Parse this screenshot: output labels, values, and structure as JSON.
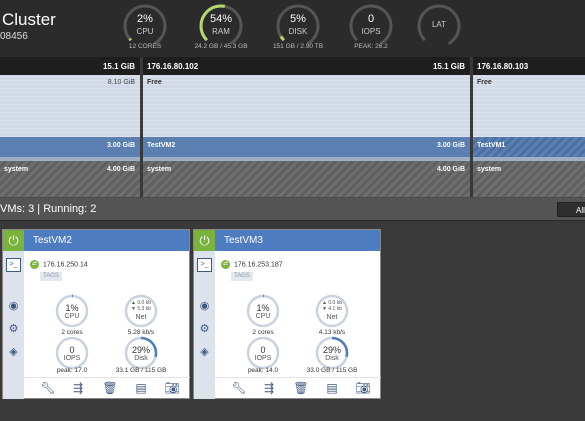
{
  "cluster": {
    "title": "Cluster",
    "id": "08456"
  },
  "gauges": [
    {
      "value": "2%",
      "label": "CPU",
      "sub": "12 CORES",
      "pct": 2
    },
    {
      "value": "54%",
      "label": "RAM",
      "sub": "24.2 GB / 45.3 GB",
      "pct": 54
    },
    {
      "value": "5%",
      "label": "DISK",
      "sub": "151 GB / 2.90 TB",
      "pct": 5
    },
    {
      "value": "0",
      "label": "IOPS",
      "sub": "PEAK: 26.2",
      "pct": 0
    },
    {
      "value": "",
      "label": "LAT",
      "sub": "",
      "pct": 0
    }
  ],
  "hosts": [
    {
      "ip": "",
      "capacity": "15.1 GiB",
      "free_label": "",
      "free_value": "8.10 GiB",
      "vm_label": "",
      "vm_value": "3.00 GiB",
      "sys_label": "system",
      "sys_value": "4.00 GiB"
    },
    {
      "ip": "176.16.80.102",
      "capacity": "15.1 GiB",
      "free_label": "Free",
      "free_value": "",
      "vm_label": "TestVM2",
      "vm_value": "3.00 GiB",
      "sys_label": "system",
      "sys_value": "4.00 GiB"
    },
    {
      "ip": "176.16.80.103",
      "capacity": "",
      "free_label": "Free",
      "free_value": "",
      "vm_label": "TestVM1",
      "vm_value": "",
      "sys_label": "system",
      "sys_value": ""
    }
  ],
  "vmbar": {
    "summary": "VMs: 3 | Running: 2",
    "all_button": "All"
  },
  "vms": [
    {
      "name": "TestVM2",
      "ip": "176.16.250.14",
      "tags": "TAGS",
      "cpu": {
        "value": "1%",
        "label": "CPU",
        "sub": "2 cores",
        "pct": 1
      },
      "net": {
        "up": "▲ 0.0 kb",
        "down": "▼ 5.3 kb",
        "label": "Net",
        "sub": "5.28 kb/s"
      },
      "iops": {
        "value": "0",
        "label": "IOPS",
        "sub": "peak: 17.0",
        "pct": 0
      },
      "disk": {
        "value": "29%",
        "label": "Disk",
        "sub": "33.1 GB / 115 GB",
        "pct": 29
      }
    },
    {
      "name": "TestVM3",
      "ip": "176.16.253.187",
      "tags": "TAGS",
      "cpu": {
        "value": "1%",
        "label": "CPU",
        "sub": "2 cores",
        "pct": 1
      },
      "net": {
        "up": "▲ 0.0 kb",
        "down": "▼ 4.1 kb",
        "label": "Net",
        "sub": "4.13 kb/s"
      },
      "iops": {
        "value": "0",
        "label": "IOPS",
        "sub": "peak: 14.0",
        "pct": 0
      },
      "disk": {
        "value": "29%",
        "label": "Disk",
        "sub": "33.0 GB / 115 GB",
        "pct": 29
      }
    }
  ],
  "colors": {
    "accent_green": "#7ab33c",
    "card_header": "#4d7cc0",
    "vm_memory": "#5a7fb0",
    "gauge_fill": "#4d7cc0"
  },
  "icons": {
    "card_sidebar": [
      "terminal-icon",
      "dashboard-icon",
      "settings-icon",
      "layers-icon"
    ],
    "card_toolbar": [
      "wrench-icon",
      "migrate-icon",
      "trash-icon",
      "snapshot-icon",
      "camera-icon"
    ]
  }
}
